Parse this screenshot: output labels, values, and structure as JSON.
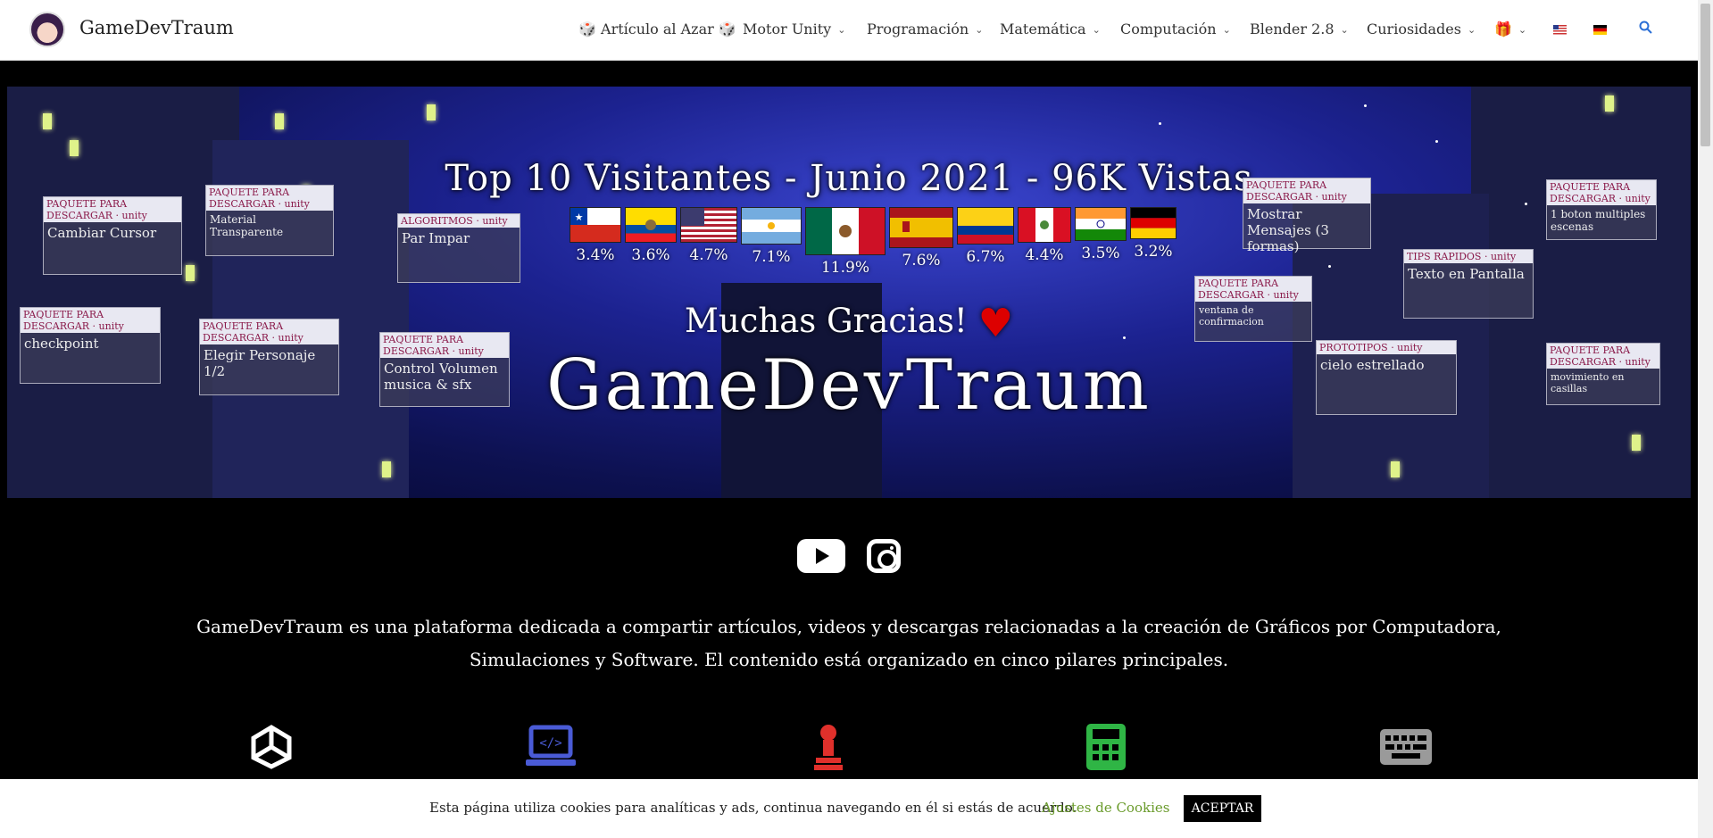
{
  "site": {
    "title": "GameDevTraum"
  },
  "nav": {
    "items": [
      {
        "label": "🎲 Artículo al Azar 🎲",
        "has_caret": false
      },
      {
        "label": "Motor Unity",
        "has_caret": true
      },
      {
        "label": "Programación",
        "has_caret": true
      },
      {
        "label": "Matemática",
        "has_caret": true
      },
      {
        "label": "Computación",
        "has_caret": true
      },
      {
        "label": "Blender 2.8",
        "has_caret": true
      },
      {
        "label": "Curiosidades",
        "has_caret": true
      }
    ],
    "icons": [
      "gift-icon",
      "us-flag-icon",
      "de-flag-icon",
      "search-icon"
    ]
  },
  "banner": {
    "title": "Top 10 Visitantes - Junio 2021 - 96K Vistas",
    "countries": [
      {
        "flag": "chile-flag-icon",
        "pct": "3.4%"
      },
      {
        "flag": "ecuador-flag-icon",
        "pct": "3.6%"
      },
      {
        "flag": "usa-flag-icon",
        "pct": "4.7%"
      },
      {
        "flag": "argentina-flag-icon",
        "pct": "7.1%"
      },
      {
        "flag": "mexico-flag-icon",
        "pct": "11.9%"
      },
      {
        "flag": "spain-flag-icon",
        "pct": "7.6%"
      },
      {
        "flag": "colombia-flag-icon",
        "pct": "6.7%"
      },
      {
        "flag": "peru-flag-icon",
        "pct": "4.4%"
      },
      {
        "flag": "india-flag-icon",
        "pct": "3.5%"
      },
      {
        "flag": "germany-flag-icon",
        "pct": "3.2%"
      }
    ],
    "thanks": "Muchas Gracias!",
    "brand": "GameDevTraum",
    "cards": [
      {
        "head": "PAQUETE PARA DESCARGAR · unity",
        "body": "Cambiar Cursor"
      },
      {
        "head": "PAQUETE PARA DESCARGAR · unity",
        "body": "Material Transparente"
      },
      {
        "head": "ALGORITMOS · unity",
        "body": "Par  Impar"
      },
      {
        "head": "PAQUETE PARA DESCARGAR · unity",
        "body": "checkpoint"
      },
      {
        "head": "PAQUETE PARA DESCARGAR · unity",
        "body": "Elegir Personaje 1/2"
      },
      {
        "head": "PAQUETE PARA DESCARGAR · unity",
        "body": "Control Volumen musica & sfx"
      },
      {
        "head": "PAQUETE PARA DESCARGAR · unity",
        "body": "Mostrar Mensajes (3 formas)"
      },
      {
        "head": "PAQUETE PARA DESCARGAR · unity",
        "body": "ventana de confirmacion"
      },
      {
        "head": "TIPS RAPIDOS · unity",
        "body": "Texto en Pantalla"
      },
      {
        "head": "PROTOTIPOS · unity",
        "body": "cielo estrellado"
      },
      {
        "head": "PAQUETE PARA DESCARGAR · unity",
        "body": "1 boton multiples escenas"
      },
      {
        "head": "PAQUETE PARA DESCARGAR · unity",
        "body": "movimiento en casillas"
      }
    ]
  },
  "social": {
    "icons": [
      "youtube-icon",
      "instagram-icon"
    ]
  },
  "intro": "GameDevTraum es una plataforma dedicada a compartir artículos, videos y descargas relacionadas a la creación de Gráficos por Computadora, Simulaciones y Software. El contenido está organizado en cinco pilares principales.",
  "pillars": [
    {
      "icon": "unity-icon",
      "color": "#ffffff"
    },
    {
      "icon": "laptop-code-icon",
      "color": "#4a5bd6"
    },
    {
      "icon": "chess-pawn-icon",
      "color": "#e0302b"
    },
    {
      "icon": "calculator-icon",
      "color": "#2fb545"
    },
    {
      "icon": "keyboard-icon",
      "color": "#9a9a9a"
    }
  ],
  "cookie": {
    "text": "Esta página utiliza cookies para analíticas y ads, continua navegando en él si estás de acuerdo.",
    "settings_label": "Ajustes de Cookies",
    "accept_label": "ACEPTAR"
  }
}
